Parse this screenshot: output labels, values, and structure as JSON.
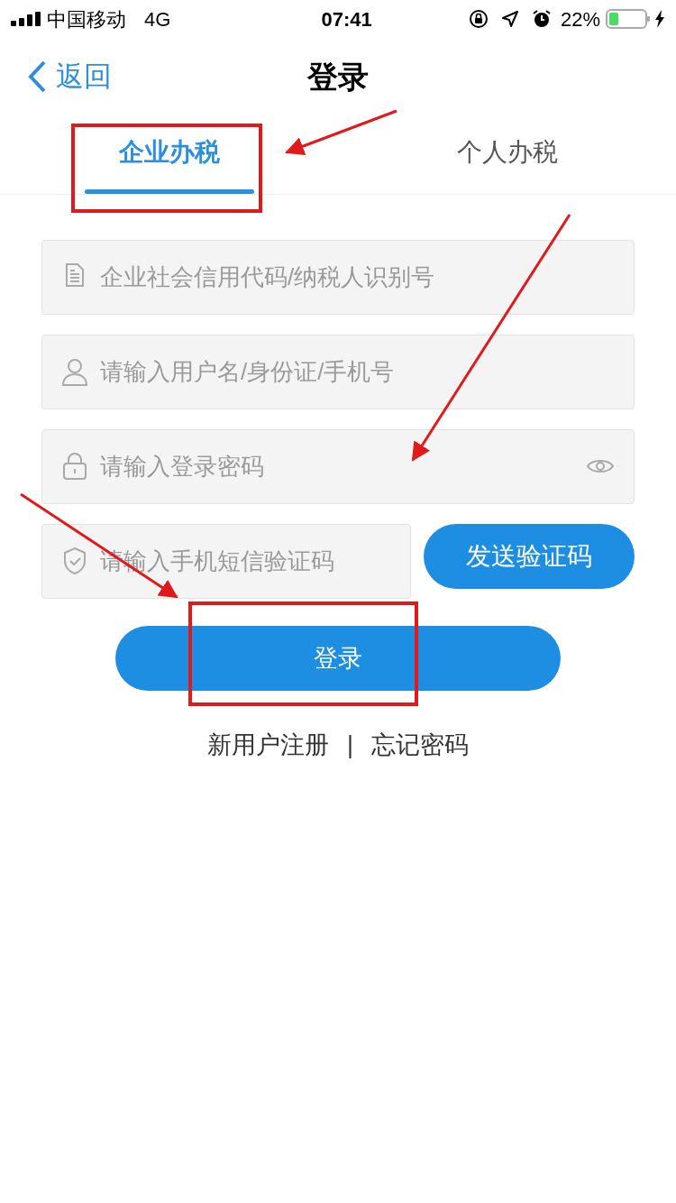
{
  "status_bar": {
    "carrier": "中国移动",
    "network": "4G",
    "time": "07:41",
    "battery": "22%"
  },
  "nav": {
    "back": "返回",
    "title": "登录"
  },
  "tabs": [
    {
      "label": "企业办税",
      "selected": true
    },
    {
      "label": "个人办税",
      "selected": false
    }
  ],
  "fields": [
    {
      "kind": "document",
      "placeholder": "企业社会信用代码/纳税人识别号"
    },
    {
      "kind": "user",
      "placeholder": "请输入用户名/身份证/手机号"
    },
    {
      "kind": "password",
      "placeholder": "请输入登录密码"
    },
    {
      "kind": "sms",
      "placeholder": "请输入手机短信验证码"
    }
  ],
  "send_code_button": "发送验证码",
  "login_button": "登录",
  "links": [
    "新用户注册",
    "忘记密码"
  ],
  "link_separator": "|"
}
